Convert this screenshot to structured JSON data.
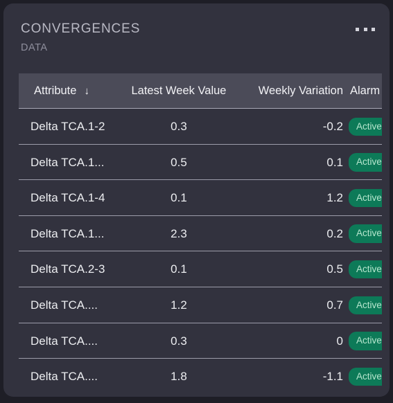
{
  "card": {
    "title": "CONVERGENCES",
    "subtitle": "DATA",
    "menu_icon": "ellipsis-horizontal-icon",
    "menu_label": "",
    "accent_color": "#0d7a58",
    "card_background": "#32323e",
    "page_background": "#1e1e26",
    "header_row_background": "#4b4b58"
  },
  "table": {
    "columns": [
      {
        "key": "attribute",
        "label": "Attribute",
        "sort": "desc",
        "sort_icon": "arrow-down-icon"
      },
      {
        "key": "latest_week_value",
        "label": "Latest Week Value"
      },
      {
        "key": "weekly_variation",
        "label": "Weekly Variation"
      },
      {
        "key": "alarm",
        "label": "Alarm"
      }
    ],
    "rows": [
      {
        "attribute": "Delta TCA.1-2",
        "latest_week_value": "0.3",
        "weekly_variation": "-0.2",
        "alarm": "Active"
      },
      {
        "attribute": "Delta TCA.1...",
        "latest_week_value": "0.5",
        "weekly_variation": "0.1",
        "alarm": "Active"
      },
      {
        "attribute": "Delta TCA.1-4",
        "latest_week_value": "0.1",
        "weekly_variation": "1.2",
        "alarm": "Active"
      },
      {
        "attribute": "Delta TCA.1...",
        "latest_week_value": "2.3",
        "weekly_variation": "0.2",
        "alarm": "Active"
      },
      {
        "attribute": "Delta TCA.2-3",
        "latest_week_value": "0.1",
        "weekly_variation": "0.5",
        "alarm": "Active"
      },
      {
        "attribute": "Delta TCA....",
        "latest_week_value": "1.2",
        "weekly_variation": "0.7",
        "alarm": "Active"
      },
      {
        "attribute": "Delta TCA....",
        "latest_week_value": "0.3",
        "weekly_variation": "0",
        "alarm": "Active"
      },
      {
        "attribute": "Delta TCA....",
        "latest_week_value": "1.8",
        "weekly_variation": "-1.1",
        "alarm": "Active"
      }
    ]
  }
}
